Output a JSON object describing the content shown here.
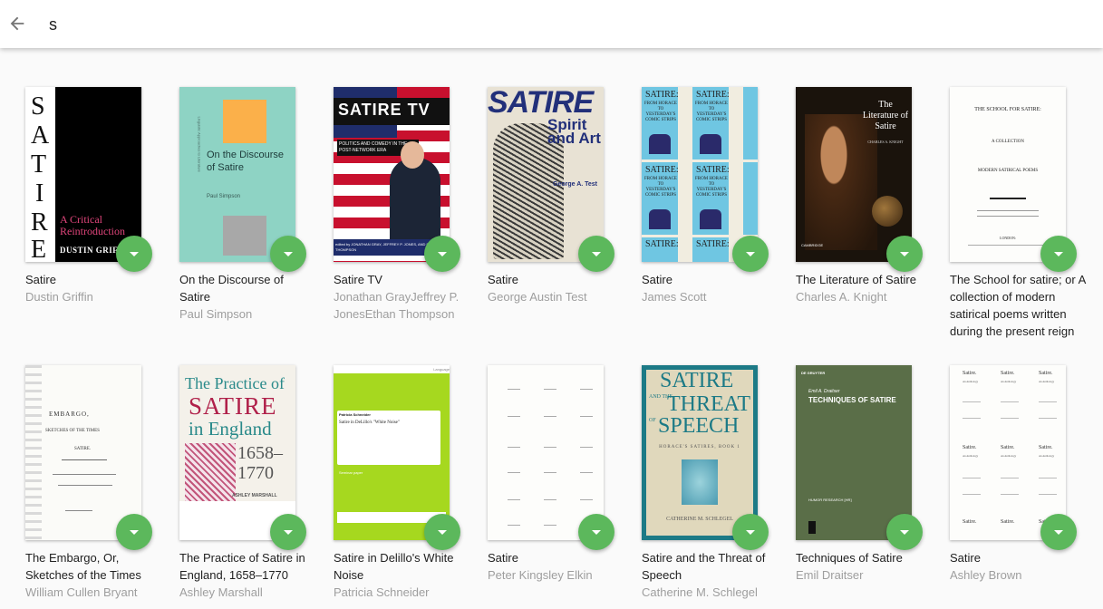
{
  "search": {
    "query": "s"
  },
  "books": [
    {
      "title": "Satire",
      "author": "Dustin Griffin",
      "cover": {
        "letters": [
          "S",
          "A",
          "T",
          "I",
          "R",
          "E"
        ],
        "sub": "A Critical Reintroduction",
        "name": "DUSTIN GRIFFIN"
      }
    },
    {
      "title": "On the Discourse of Satire",
      "author": "Paul Simpson",
      "cover": {
        "title": "On the Discourse of Satire",
        "name": "Paul Simpson",
        "spine": "Linguistic Approaches to Literature"
      }
    },
    {
      "title": "Satire TV",
      "author": "Jonathan GrayJeffrey P. JonesEthan Thompson",
      "cover": {
        "title": "SATIRE TV",
        "sub": "POLITICS AND COMEDY IN THE POST-NETWORK ERA",
        "editors": "edited by JONATHAN GRAY, JEFFREY P. JONES, AND ETHAN THOMPSON"
      }
    },
    {
      "title": "Satire",
      "author": "George Austin Test",
      "cover": {
        "title": "SATIRE",
        "sub": "Spirit and Art",
        "name": "George A. Test"
      }
    },
    {
      "title": "Satire",
      "author": "James Scott",
      "cover": {
        "tile1": "SATIRE:",
        "tile2": "FROM HORACE TO YESTERDAY'S COMIC STRIPS"
      }
    },
    {
      "title": "The Literature of Satire",
      "author": "Charles A. Knight",
      "cover": {
        "title": "The Literature of Satire",
        "name": "CHARLES A. KNIGHT",
        "imprint": "CAMBRIDGE"
      }
    },
    {
      "title": "The School for satire; or A collection of modern satirical poems written during the present reign",
      "author": "",
      "cover": {
        "line1": "THE SCHOOL FOR SATIRE:",
        "line2": "A COLLECTION",
        "line3": "MODERN SATIRICAL POEMS",
        "line4": "LONDON:"
      }
    },
    {
      "title": "The Embargo, Or, Sketches of the Times",
      "author": "William Cullen Bryant",
      "cover": {
        "line1": "EMBARGO,",
        "line2": "SKETCHES OF THE TIMES",
        "line3": "SATIRE."
      }
    },
    {
      "title": "The Practice of Satire in England, 1658–1770",
      "author": "Ashley Marshall",
      "cover": {
        "l1": "The Practice of",
        "l2": "SATIRE",
        "l3": "in England",
        "l4": "1658–",
        "l5": "1770",
        "name": "ASHLEY MARSHALL"
      }
    },
    {
      "title": "Satire in Delillo's White Noise",
      "author": "Patricia Schneider",
      "cover": {
        "name": "Patricia Schneider",
        "sub": "Satire in DeLillo's \"White Noise\"",
        "label": "Seminar paper",
        "top": "Language"
      }
    },
    {
      "title": "Satire",
      "author": "Peter Kingsley Elkin",
      "cover": {}
    },
    {
      "title": "Satire and the Threat of Speech",
      "author": "Catherine M. Schlegel",
      "cover": {
        "l1": "SATIRE",
        "l2": "AND THE",
        "l3": "THREAT",
        "l4": "OF",
        "l5": "SPEECH",
        "sub": "HORACE'S SATIRES, BOOK 1",
        "name": "CATHERINE M. SCHLEGEL"
      }
    },
    {
      "title": "Techniques of Satire",
      "author": "Emil Draitser",
      "cover": {
        "pub": "DE GRUYTER",
        "name": "Emil A. Draitser",
        "title": "TECHNIQUES OF SATIRE",
        "series": "HUMOR RESEARCH [HR]"
      }
    },
    {
      "title": "Satire",
      "author": "Ashley Brown",
      "cover": {
        "tile": "Satire.",
        "tile2": "An Anthology"
      }
    }
  ]
}
